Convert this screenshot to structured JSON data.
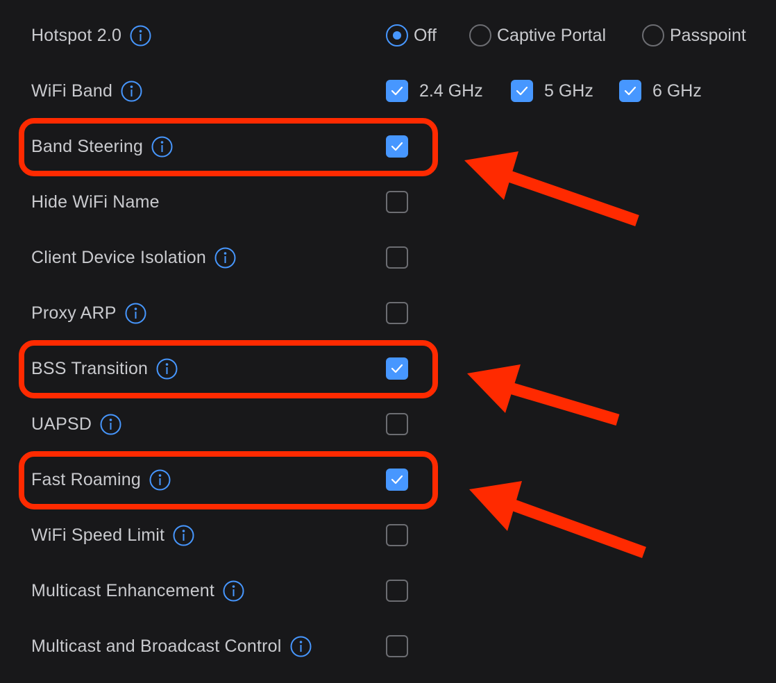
{
  "settings": {
    "hotspot": {
      "label": "Hotspot 2.0",
      "options": [
        "Off",
        "Captive Portal",
        "Passpoint"
      ],
      "selected": "Off"
    },
    "wifi_band": {
      "label": "WiFi Band",
      "options": [
        {
          "label": "2.4 GHz",
          "checked": true
        },
        {
          "label": "5 GHz",
          "checked": true
        },
        {
          "label": "6 GHz",
          "checked": true
        }
      ]
    },
    "band_steering": {
      "label": "Band Steering",
      "checked": true
    },
    "hide_wifi_name": {
      "label": "Hide WiFi Name",
      "checked": false
    },
    "client_device_isolation": {
      "label": "Client Device Isolation",
      "checked": false
    },
    "proxy_arp": {
      "label": "Proxy ARP",
      "checked": false
    },
    "bss_transition": {
      "label": "BSS Transition",
      "checked": true
    },
    "uapsd": {
      "label": "UAPSD",
      "checked": false
    },
    "fast_roaming": {
      "label": "Fast Roaming",
      "checked": true
    },
    "wifi_speed_limit": {
      "label": "WiFi Speed Limit",
      "checked": false
    },
    "multicast_enhancement": {
      "label": "Multicast Enhancement",
      "checked": false
    },
    "multicast_broadcast_control": {
      "label": "Multicast and Broadcast Control",
      "checked": false
    }
  },
  "icons": {
    "info": "info-circle-icon",
    "check": "checkmark-icon"
  },
  "colors": {
    "background": "#18181a",
    "text": "#c9cace",
    "accent": "#4797ff",
    "checkbox_border": "#6c6d72",
    "annotation": "#ff2a00"
  }
}
